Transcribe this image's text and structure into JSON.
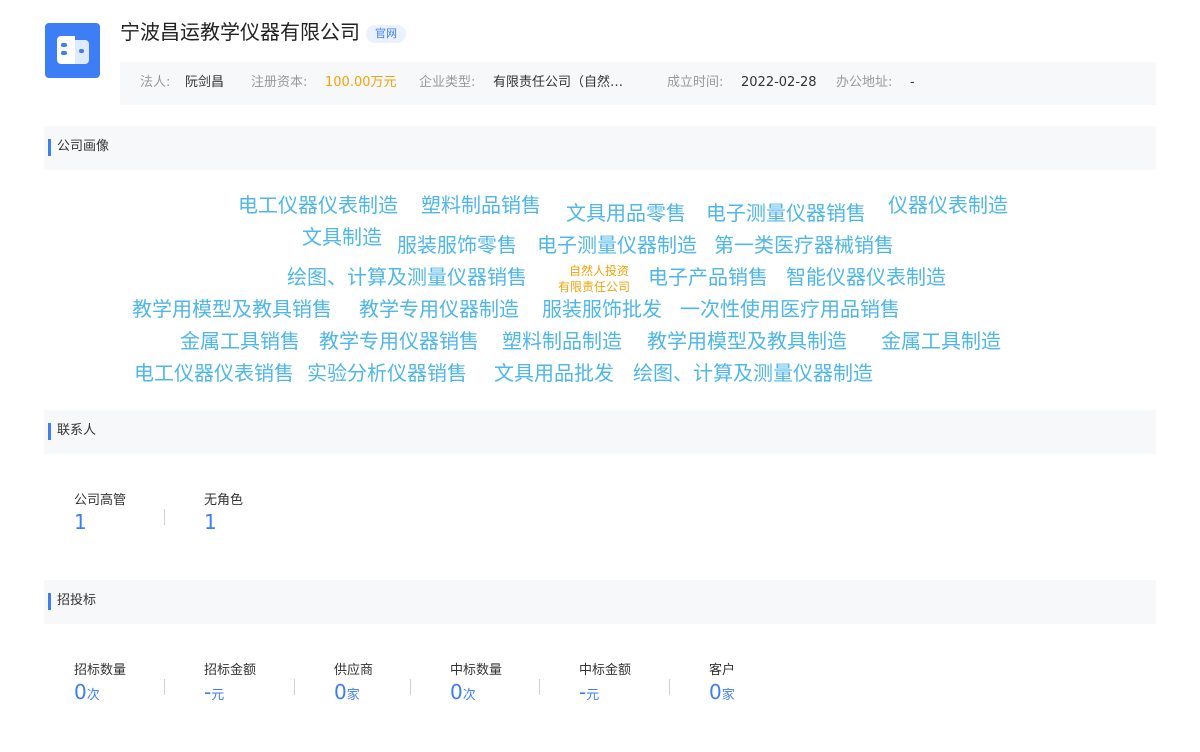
{
  "company": {
    "name": "宁波昌运教学仪器有限公司",
    "website_badge": "官网",
    "logo_icon": "building-icon",
    "accent_color": "#3d7df5"
  },
  "info": {
    "legal_rep_label": "法人:",
    "legal_rep": "阮剑昌",
    "capital_label": "注册资本:",
    "capital": "100.00万元",
    "type_label": "企业类型:",
    "type": "有限责任公司（自然…",
    "founded_label": "成立时间:",
    "founded": "2022-02-28",
    "address_label": "办公地址:",
    "address": "-"
  },
  "portrait": {
    "title": "公司画像",
    "tags": [
      "电工仪器仪表制造",
      "塑料制品销售",
      "文具用品零售",
      "电子测量仪器销售",
      "仪器仪表制造",
      "文具制造",
      "服装服饰零售",
      "电子测量仪器制造",
      "第一类医疗器械销售",
      "绘图、计算及测量仪器销售",
      "电子产品销售",
      "智能仪器仪表制造",
      "教学用模型及教具销售",
      "教学专用仪器制造",
      "服装服饰批发",
      "一次性使用医疗用品销售",
      "金属工具销售",
      "教学专用仪器销售",
      "塑料制品制造",
      "教学用模型及教具制造",
      "金属工具制造",
      "电工仪器仪表销售",
      "实验分析仪器销售",
      "文具用品批发",
      "绘图、计算及测量仪器制造"
    ],
    "type_tag_line1": "自然人投资",
    "type_tag_line2": "有限责任公司",
    "tag_color": "#4fb6e8",
    "highlight_color": "#f2a20a"
  },
  "contacts": {
    "title": "联系人",
    "stats": [
      {
        "label": "公司高管",
        "value": "1"
      },
      {
        "label": "无角色",
        "value": "1"
      }
    ]
  },
  "bidding": {
    "title": "招投标",
    "stats": [
      {
        "label": "招标数量",
        "value": "0",
        "unit": "次"
      },
      {
        "label": "招标金额",
        "value": "-",
        "unit": "元"
      },
      {
        "label": "供应商",
        "value": "0",
        "unit": "家"
      },
      {
        "label": "中标数量",
        "value": "0",
        "unit": "次"
      },
      {
        "label": "中标金额",
        "value": "-",
        "unit": "元"
      },
      {
        "label": "客户",
        "value": "0",
        "unit": "家"
      }
    ]
  }
}
